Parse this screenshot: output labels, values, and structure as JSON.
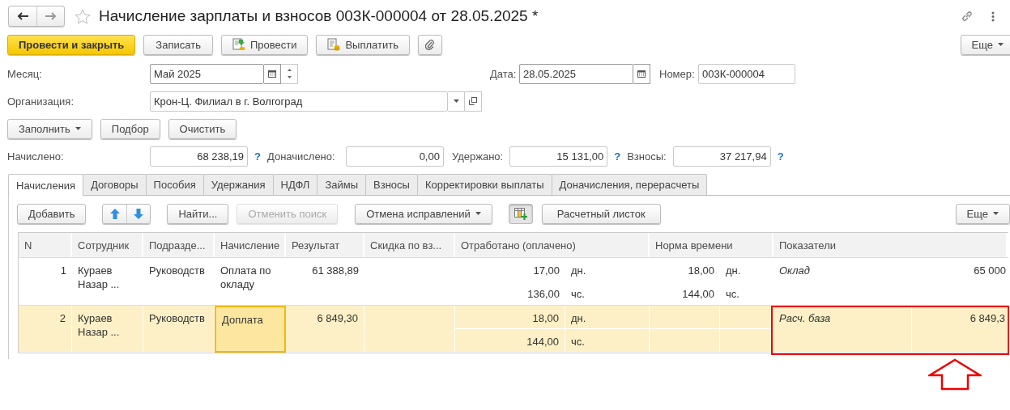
{
  "window": {
    "title": "Начисление зарплаты и взносов 003К-000004 от 28.05.2025 *"
  },
  "command_bar": {
    "primary": "Провести и закрыть",
    "buttons": [
      {
        "kind": "plain",
        "label": "Записать"
      },
      {
        "kind": "post",
        "label": "Провести"
      },
      {
        "kind": "pay",
        "label": "Выплатить"
      },
      {
        "kind": "attach"
      }
    ],
    "more": "Еще"
  },
  "month": {
    "label": "Месяц:",
    "value": "Май 2025"
  },
  "date": {
    "label": "Дата:",
    "value": "28.05.2025"
  },
  "number": {
    "label": "Номер:",
    "value": "003К-000004"
  },
  "organization": {
    "label": "Организация:",
    "value": "Крон-Ц. Филиал в г. Волгоград"
  },
  "fill_buttons": [
    {
      "label": "Заполнить",
      "dropdown": true
    },
    {
      "label": "Подбор",
      "dropdown": false
    },
    {
      "label": "Очистить",
      "dropdown": false
    }
  ],
  "totals": [
    {
      "label": "Начислено:",
      "value": "68 238,19",
      "help": "?"
    },
    {
      "label": "Доначислено:",
      "value": "0,00"
    },
    {
      "label": "Удержано:",
      "value": "15 131,00",
      "help": "?"
    },
    {
      "label": "Взносы:",
      "value": "37 217,94",
      "help": "?"
    }
  ],
  "tabs": [
    {
      "label": "Начисления",
      "selected": true
    },
    {
      "label": "Договоры",
      "selected": false
    },
    {
      "label": "Пособия",
      "selected": false
    },
    {
      "label": "Удержания",
      "selected": false
    },
    {
      "label": "НДФЛ",
      "selected": false
    },
    {
      "label": "Займы",
      "selected": false
    },
    {
      "label": "Взносы",
      "selected": false
    },
    {
      "label": "Корректировки выплаты",
      "selected": false
    },
    {
      "label": "Доначисления, перерасчеты",
      "selected": false
    }
  ],
  "table_toolbar": {
    "add": "Добавить",
    "find": "Найти...",
    "cancel_search": {
      "label": "Отменить поиск",
      "disabled": true
    },
    "cancel_fixes": "Отмена исправлений",
    "payslip": "Расчетный листок",
    "more": "Еще"
  },
  "table": {
    "columns": [
      "N",
      "Сотрудник",
      "Подразде...",
      "Начисление",
      "Результат",
      "Скидка по вз...",
      "Отработано (оплачено)",
      "Норма времени",
      "Показатели"
    ],
    "rows": [
      {
        "n": "1",
        "employee": "Кураев Назар ...",
        "department": "Руководств",
        "accrual": "Оплата по окладу",
        "result": "61 388,89",
        "worked": [
          {
            "value": "17,00",
            "unit": "дн."
          },
          {
            "value": "136,00",
            "unit": "чс."
          }
        ],
        "norm": [
          {
            "value": "18,00",
            "unit": "дн."
          },
          {
            "value": "144,00",
            "unit": "чс."
          }
        ],
        "indicator": {
          "name": "Оклад",
          "value": "65 000",
          "highlighted": false
        },
        "selected": false,
        "accrual_focused": false
      },
      {
        "n": "2",
        "employee": "Кураев Назар ...",
        "department": "Руководств",
        "accrual": "Доплата",
        "result": "6 849,30",
        "worked": [
          {
            "value": "18,00",
            "unit": "дн."
          },
          {
            "value": "144,00",
            "unit": "чс."
          }
        ],
        "norm": [],
        "indicator": {
          "name": "Расч. база",
          "value": "6 849,3",
          "highlighted": true
        },
        "selected": true,
        "accrual_focused": true
      }
    ]
  }
}
